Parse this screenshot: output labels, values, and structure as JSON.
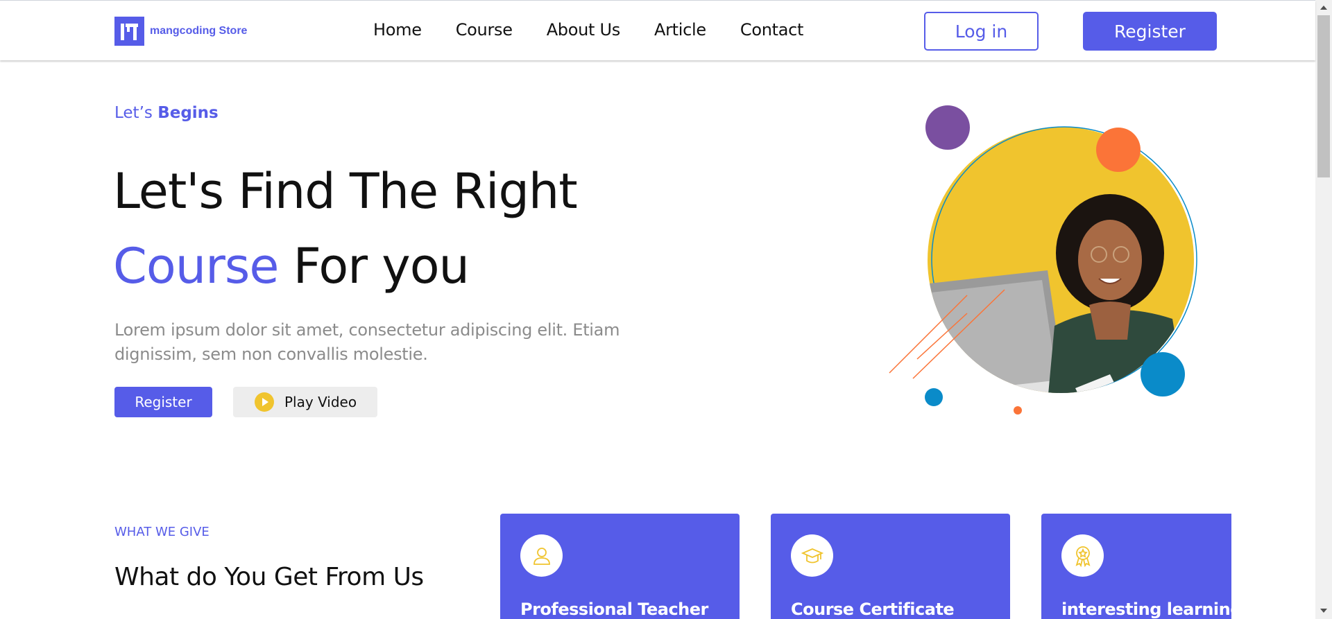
{
  "header": {
    "logo_text": "mangcoding Store",
    "nav": [
      "Home",
      "Course",
      "About Us",
      "Article",
      "Contact"
    ],
    "login_label": "Log in",
    "register_label": "Register"
  },
  "hero": {
    "eyebrow_prefix": "Let’s",
    "eyebrow_bold": "Begins",
    "title_line1": "Let's Find The Right",
    "title_accent": "Course",
    "title_rest": " For you",
    "description": "Lorem ipsum dolor sit amet, consectetur adipiscing elit. Etiam dignissim, sem non convallis molestie.",
    "register_label": "Register",
    "play_label": "Play Video"
  },
  "features": {
    "eyebrow": "WHAT WE GIVE",
    "title": "What do You Get From Us",
    "cards": [
      {
        "title": "Professional Teacher",
        "icon": "user-icon"
      },
      {
        "title": "Course Certificate",
        "icon": "graduation-cap-icon"
      },
      {
        "title": "interesting learning",
        "icon": "award-icon"
      }
    ]
  },
  "colors": {
    "accent": "#565ce8",
    "yellow": "#f0c42e",
    "purple": "#7a4fa0",
    "orange": "#fb7438",
    "blue": "#0a8bc9"
  }
}
